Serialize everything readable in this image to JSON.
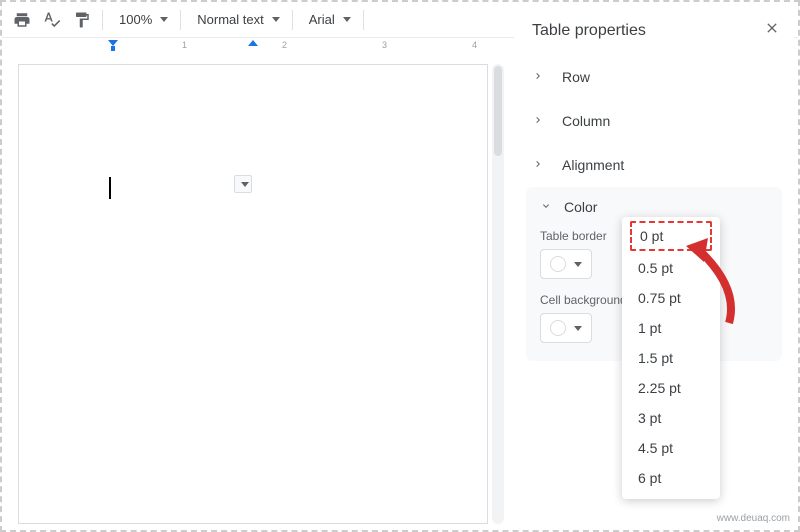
{
  "toolbar": {
    "zoom": "100%",
    "style": "Normal text",
    "font": "Arial"
  },
  "ruler": {
    "marks": [
      "1",
      "2",
      "3",
      "4"
    ]
  },
  "sidebar": {
    "title": "Table properties",
    "sections": {
      "row": "Row",
      "column": "Column",
      "alignment": "Alignment",
      "color": "Color"
    },
    "color_panel": {
      "border_label": "Table border",
      "bg_label": "Cell background"
    }
  },
  "pt_menu": {
    "items": [
      "0 pt",
      "0.5 pt",
      "0.75 pt",
      "1 pt",
      "1.5 pt",
      "2.25 pt",
      "3 pt",
      "4.5 pt",
      "6 pt"
    ],
    "highlighted_index": 0
  },
  "watermark": "www.deuaq.com"
}
